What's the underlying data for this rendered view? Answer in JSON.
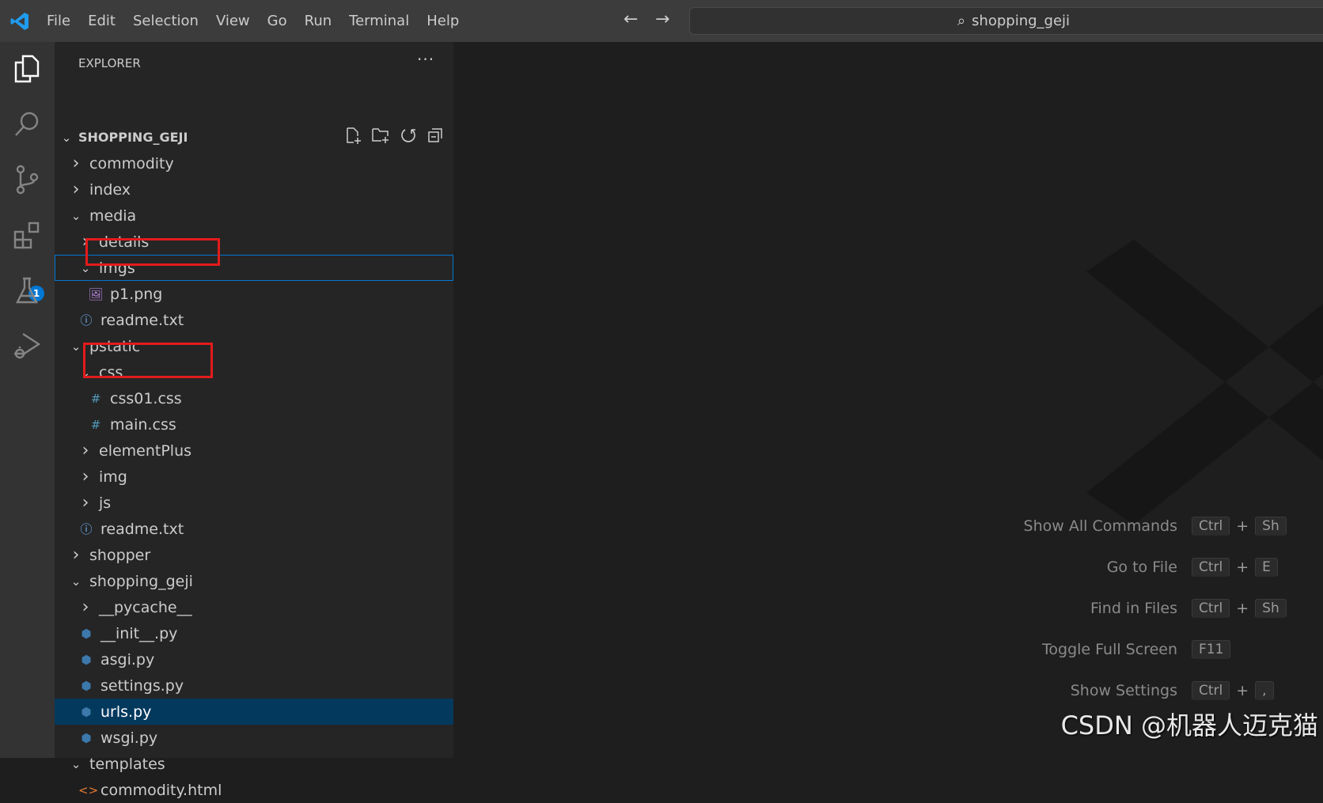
{
  "titlebar": {
    "menus": [
      "File",
      "Edit",
      "Selection",
      "View",
      "Go",
      "Run",
      "Terminal",
      "Help"
    ],
    "search": "shopping_geji"
  },
  "activity": {
    "extensions_badge": "1"
  },
  "explorer": {
    "title": "EXPLORER",
    "more": "···",
    "root": "SHOPPING_GEJI",
    "rows": [
      {
        "label": "commodity",
        "depth": 1,
        "type": "folder",
        "open": false
      },
      {
        "label": "index",
        "depth": 1,
        "type": "folder",
        "open": false
      },
      {
        "label": "media",
        "depth": 1,
        "type": "folder",
        "open": true
      },
      {
        "label": "details",
        "depth": 2,
        "type": "folder",
        "open": false
      },
      {
        "label": "imgs",
        "depth": 2,
        "type": "folder",
        "open": true,
        "focused": true
      },
      {
        "label": "p1.png",
        "depth": 3,
        "type": "image",
        "highlighted": true
      },
      {
        "label": "readme.txt",
        "depth": 2,
        "type": "info"
      },
      {
        "label": "pstatic",
        "depth": 1,
        "type": "folder",
        "open": true
      },
      {
        "label": "css",
        "depth": 2,
        "type": "folder",
        "open": true
      },
      {
        "label": "css01.css",
        "depth": 3,
        "type": "css",
        "highlighted": true
      },
      {
        "label": "main.css",
        "depth": 3,
        "type": "css"
      },
      {
        "label": "elementPlus",
        "depth": 2,
        "type": "folder",
        "open": false
      },
      {
        "label": "img",
        "depth": 2,
        "type": "folder",
        "open": false
      },
      {
        "label": "js",
        "depth": 2,
        "type": "folder",
        "open": false
      },
      {
        "label": "readme.txt",
        "depth": 2,
        "type": "info"
      },
      {
        "label": "shopper",
        "depth": 1,
        "type": "folder",
        "open": false
      },
      {
        "label": "shopping_geji",
        "depth": 1,
        "type": "folder",
        "open": true
      },
      {
        "label": "__pycache__",
        "depth": 2,
        "type": "folder",
        "open": false
      },
      {
        "label": "__init__.py",
        "depth": 2,
        "type": "python"
      },
      {
        "label": "asgi.py",
        "depth": 2,
        "type": "python"
      },
      {
        "label": "settings.py",
        "depth": 2,
        "type": "python"
      },
      {
        "label": "urls.py",
        "depth": 2,
        "type": "python",
        "selected": true
      },
      {
        "label": "wsgi.py",
        "depth": 2,
        "type": "python"
      },
      {
        "label": "templates",
        "depth": 1,
        "type": "folder",
        "open": true
      },
      {
        "label": "commodity.html",
        "depth": 2,
        "type": "html"
      }
    ]
  },
  "shortcuts": [
    {
      "label": "Show All Commands",
      "keys": [
        "Ctrl",
        "Sh"
      ]
    },
    {
      "label": "Go to File",
      "keys": [
        "Ctrl",
        "E"
      ]
    },
    {
      "label": "Find in Files",
      "keys": [
        "Ctrl",
        "Sh"
      ]
    },
    {
      "label": "Toggle Full Screen",
      "keys": [
        "F11"
      ]
    },
    {
      "label": "Show Settings",
      "keys": [
        "Ctrl",
        ","
      ]
    }
  ],
  "watermark": "CSDN @机器人迈克猫",
  "colors": {
    "accent": "#0078d4",
    "highlight": "#e31b1b",
    "selected": "#04395e"
  }
}
